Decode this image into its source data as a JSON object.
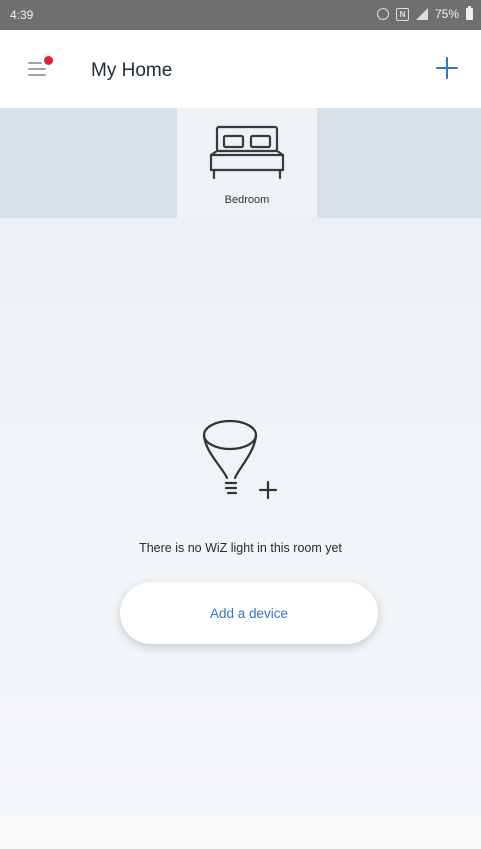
{
  "status_bar": {
    "time": "4:39",
    "battery": "75%",
    "icons": [
      "alarm-icon",
      "nfc-icon",
      "signal-icon",
      "battery-icon"
    ]
  },
  "header": {
    "title": "My Home",
    "menu_icon": "menu-icon",
    "notification_dot_color": "#e0223a",
    "add_icon": "plus-icon"
  },
  "rooms": [
    {
      "name": "Bedroom",
      "icon": "bed-icon",
      "selected": true
    }
  ],
  "empty_state": {
    "icon": "bulb-add-icon",
    "message": "There is no WiZ light in this room yet",
    "button_label": "Add a device"
  },
  "colors": {
    "accent": "#2c79c7",
    "status_bar": "#6f6f6f",
    "rooms_strip": "#d6e0e8"
  }
}
